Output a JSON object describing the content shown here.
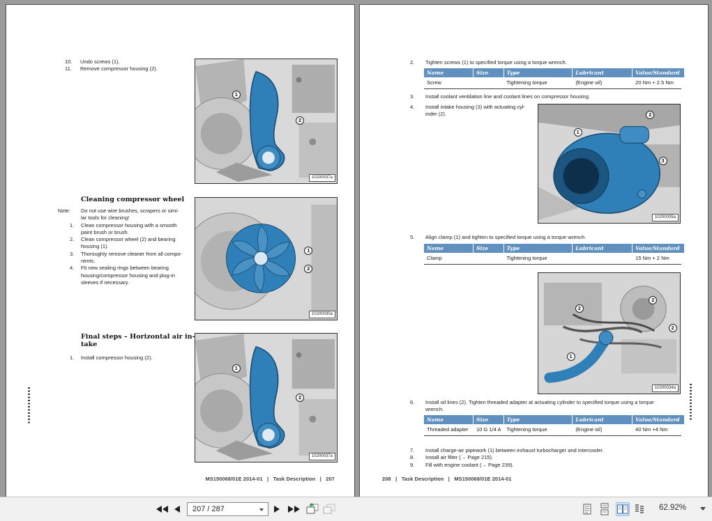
{
  "table_headers": [
    "Name",
    "Size",
    "Type",
    "Lubricant",
    "Value/Standard"
  ],
  "left_page": {
    "top_steps": [
      {
        "num": "10.",
        "text": "Undo screws (1)."
      },
      {
        "num": "11.",
        "text": "Remove compressor housing (2)."
      }
    ],
    "cleaning": {
      "heading": "Cleaning compressor wheel",
      "note_label": "Note:",
      "note_text": "Do not use wire brushes, scrapers or simi-\nlar tools for cleaning!",
      "steps": [
        {
          "num": "1.",
          "text": "Clean compressor housing with a smooth\npaint brush or brush."
        },
        {
          "num": "2.",
          "text": "Clean compressor wheel (2) and bearing\nhousing (1)."
        },
        {
          "num": "3.",
          "text": "Thoroughly remove cleaner from all compo-\nnents."
        },
        {
          "num": "4.",
          "text": "Fit new sealing rings between bearing\nhousing/compressor housing and plug-in\nsleeves if necessary."
        }
      ]
    },
    "final_steps": {
      "heading": "Final steps – Horizontal air in-\ntake",
      "steps": [
        {
          "num": "1.",
          "text": "Install compressor housing (2)."
        }
      ]
    },
    "figures": {
      "fig1": {
        "label": "10200037a",
        "callouts": [
          "1",
          "2"
        ]
      },
      "fig2": {
        "label": "10200030a",
        "callouts": [
          "1",
          "2"
        ]
      },
      "fig3": {
        "label": "10200037a",
        "callouts": [
          "1",
          "2"
        ]
      }
    },
    "footer": "MS150068/01E 2014-01   |   Task Description   |   207"
  },
  "right_page": {
    "steps": {
      "s2": {
        "num": "2.",
        "text": "Tighten screws (1) to specified torque using a torque wrench."
      },
      "s3": {
        "num": "3.",
        "text": "Install coolant ventilation line and coolant lines on compressor housing."
      },
      "s4": {
        "num": "4.",
        "text": "Install intake housing (3) with actuating cyl-\ninder (2)."
      },
      "s5": {
        "num": "5.",
        "text": "Align clamp (1) and tighten to specified torque using a torque wrench."
      },
      "s6": {
        "num": "6.",
        "text": "Install oil lines (2). Tighten threaded adapter at actuating cylinder to specified torque using a torque\nwrench."
      },
      "s7": {
        "num": "7.",
        "text": "Install charge-air pipework (1) between exhaust turbocharger and intercooler."
      },
      "s8": {
        "num": "8.",
        "text": "Install air filter (→ Page 215)."
      },
      "s9": {
        "num": "9.",
        "text": "Fill with engine coolant (→ Page 239)."
      }
    },
    "tables": [
      {
        "row": [
          "Screw",
          "",
          "Tightening torque",
          "(Engine oil)",
          "20 Nm + 2.5 Nm"
        ]
      },
      {
        "row": [
          "Clamp",
          "",
          "Tightening torque",
          "",
          "15 Nm + 2 Nm"
        ]
      },
      {
        "row": [
          "Threaded adapter",
          "10 G 1/4 A",
          "Tightening torque",
          "(Engine oil)",
          "40 Nm +4 Nm"
        ]
      }
    ],
    "figures": {
      "fig1": {
        "label": "10200035a",
        "callouts": [
          "1",
          "2",
          "3"
        ]
      },
      "fig2": {
        "label": "10200034a",
        "callouts": [
          "2",
          "2",
          "2",
          "1"
        ]
      }
    },
    "footer": "208   |   Task Description   |   MS150068/01E 2014-01"
  },
  "toolbar": {
    "page_field_value": "207 / 287",
    "zoom_value": "62.92%",
    "icons": [
      "first-page",
      "previous-page",
      "next-page",
      "last-page",
      "previous-view",
      "next-view",
      "single-page-view",
      "continuous-view",
      "two-page-view",
      "two-page-continuous-view",
      "zoom-dropdown"
    ],
    "selected_view": "two-page-view",
    "accent_selected_bg": "#cde2f6"
  },
  "colors": {
    "canvas_background": "#9b9b9b",
    "table_header_blue": "#6090c0",
    "highlight_part_blue": "#2f80b8"
  }
}
